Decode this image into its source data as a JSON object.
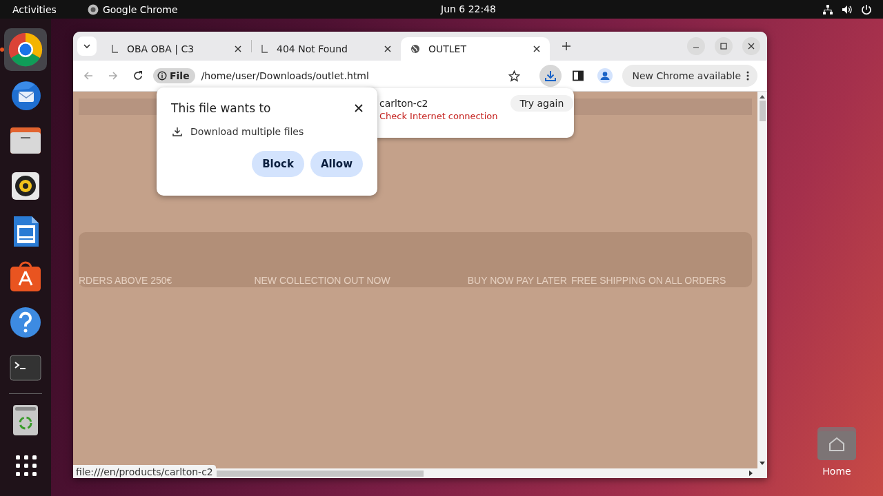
{
  "top_bar": {
    "activities": "Activities",
    "app": "Google Chrome",
    "clock": "Jun 6  22:48"
  },
  "dock": {
    "items": [
      {
        "kind": "chrome",
        "selected": true,
        "running": true
      },
      {
        "kind": "mail",
        "selected": false,
        "running": false
      },
      {
        "kind": "files",
        "selected": false,
        "running": false
      },
      {
        "kind": "music",
        "selected": false,
        "running": false
      },
      {
        "kind": "writer",
        "selected": false,
        "running": false
      },
      {
        "kind": "store",
        "selected": false,
        "running": false
      },
      {
        "kind": "help",
        "selected": false,
        "running": false
      },
      {
        "kind": "terminal",
        "selected": false,
        "running": false
      }
    ],
    "bottom_items": [
      {
        "kind": "trash",
        "selected": false,
        "running": false
      },
      {
        "kind": "apps",
        "selected": false,
        "running": false
      }
    ]
  },
  "desktop": {
    "home_label": "Home"
  },
  "browser": {
    "tabs": [
      {
        "title": "OBA OBA | C3",
        "kind": "loading",
        "selected": false
      },
      {
        "title": "404 Not Found",
        "kind": "loading",
        "selected": false
      },
      {
        "title": "OUTLET",
        "kind": "page",
        "selected": true
      }
    ],
    "toolbar": {
      "chip": "File",
      "url": "/home/user/Downloads/outlet.html",
      "update": "New Chrome available"
    },
    "status_url": "file:///en/products/carlton-c2"
  },
  "permission_popup": {
    "title": "This file wants to",
    "permission": "Download multiple files",
    "buttons": [
      "Block",
      "Allow"
    ]
  },
  "download_bubble": {
    "filename": "carlton-c2",
    "status": "Check Internet connection",
    "action": "Try again"
  },
  "page": {
    "ticker": [
      "RDERS ABOVE 250€",
      "NEW COLLECTION OUT NOW",
      "BUY NOW PAY LATER",
      "FREE SHIPPING ON ALL ORDERS"
    ]
  }
}
